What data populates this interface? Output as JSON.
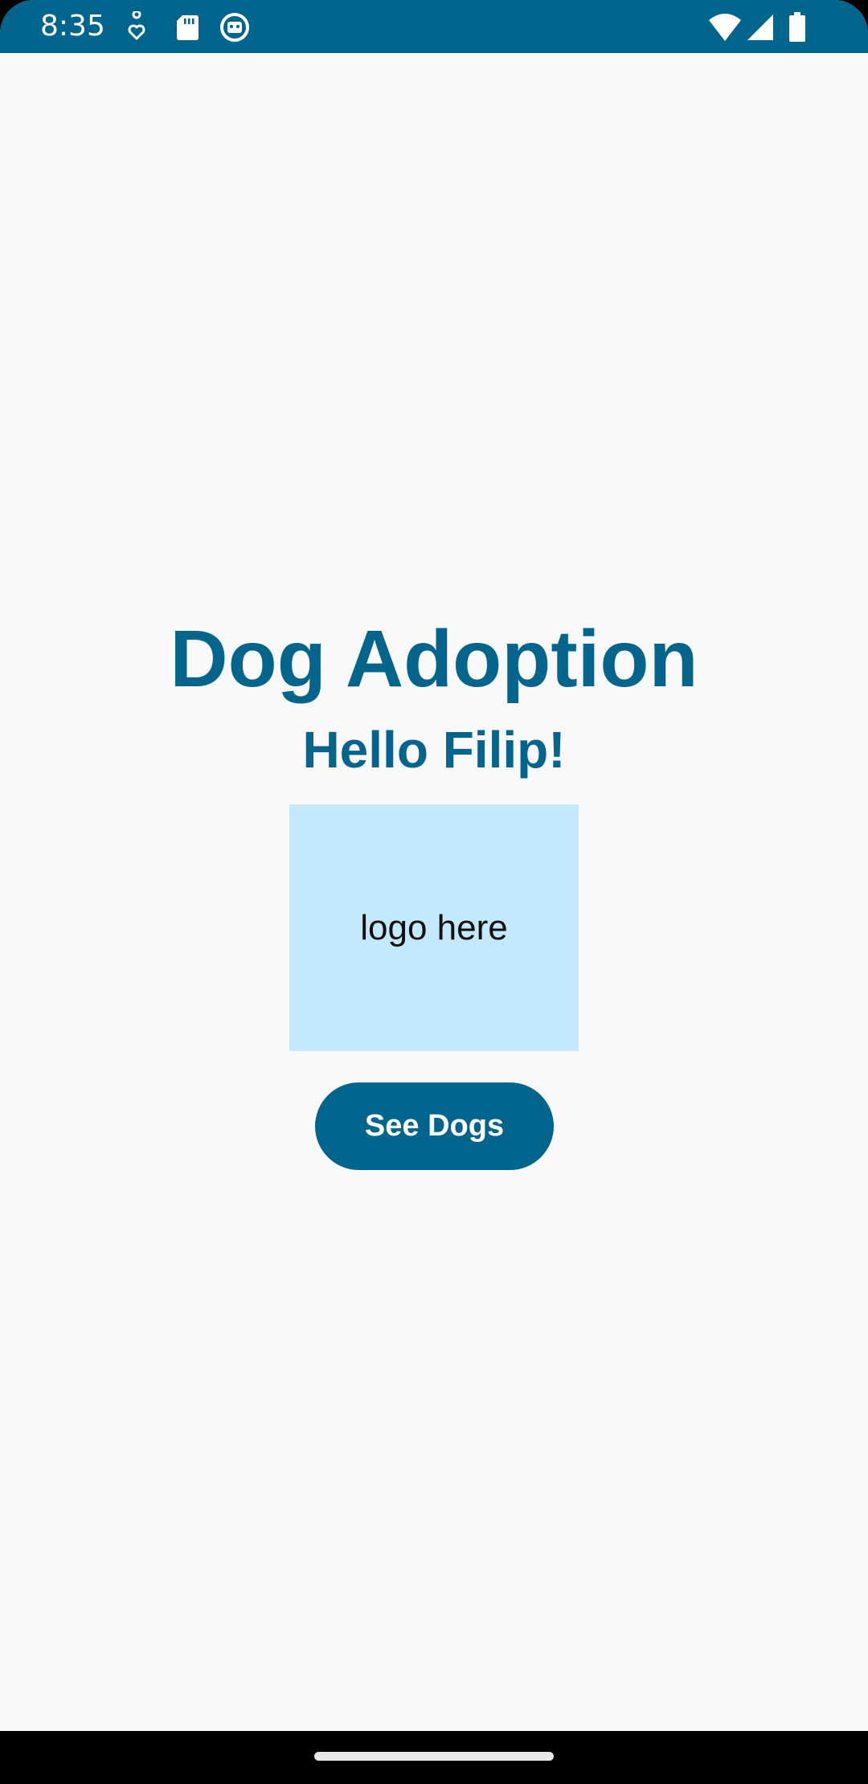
{
  "status_bar": {
    "time": "8:35",
    "color": "#00658c",
    "left_icons": [
      "podcast-heart-icon",
      "sd-card-icon",
      "app-face-icon"
    ],
    "right_icons": [
      "wifi-icon",
      "cell-signal-icon",
      "battery-icon"
    ]
  },
  "main": {
    "title": "Dog Adoption",
    "greeting": "Hello Filip!",
    "logo_placeholder": "logo here",
    "see_dogs_label": "See Dogs"
  },
  "colors": {
    "primary": "#00658c",
    "logo_background": "#c4e8fd",
    "screen_background": "#f9f9fa"
  }
}
